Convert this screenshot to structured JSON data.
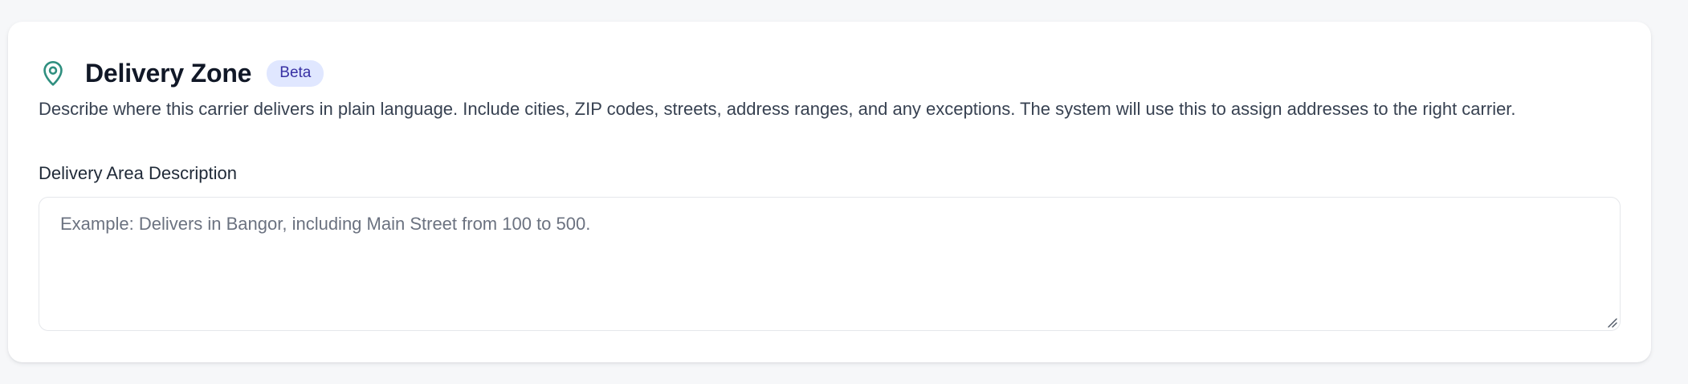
{
  "zone": {
    "title": "Delivery Zone",
    "badge": "Beta",
    "description": "Describe where this carrier delivers in plain language. Include cities, ZIP codes, streets, address ranges, and any exceptions. The system will use this to assign addresses to the right carrier.",
    "icon": "map-pin-icon"
  },
  "field": {
    "label": "Delivery Area Description",
    "value": "",
    "placeholder": "Example: Delivers in Bangor, including Main Street from 100 to 500."
  },
  "colors": {
    "icon": "#2f8f7f",
    "badge_bg": "#e0e7ff",
    "badge_text": "#3730a3"
  }
}
